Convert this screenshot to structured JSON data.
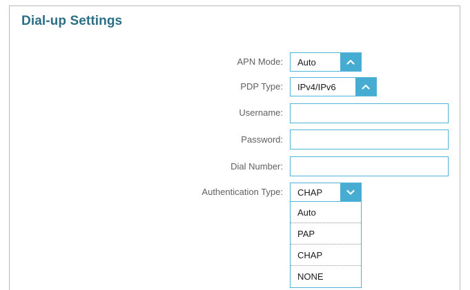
{
  "section": {
    "title": "Dial-up Settings"
  },
  "apn_mode": {
    "label": "APN Mode:",
    "value": "Auto"
  },
  "pdp_type": {
    "label": "PDP Type:",
    "value": "IPv4/IPv6"
  },
  "username": {
    "label": "Username:",
    "value": ""
  },
  "password": {
    "label": "Password:",
    "value": ""
  },
  "dial_number": {
    "label": "Dial Number:",
    "value": ""
  },
  "auth_type": {
    "label": "Authentication Type:",
    "value": "CHAP",
    "expanded": true,
    "options": [
      "Auto",
      "PAP",
      "CHAP",
      "NONE"
    ]
  },
  "colors": {
    "title": "#2b6f86",
    "accent": "#47acd2",
    "field_border": "#4fb4d8",
    "label_text": "#5f5f5f"
  },
  "icons": {
    "collapsed": "chevron-up-icon",
    "expanded": "chevron-down-icon"
  }
}
